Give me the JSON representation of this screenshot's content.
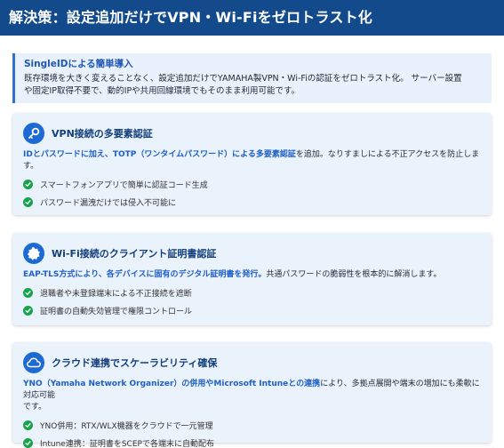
{
  "header": {
    "title": "解決策：設定追加だけでVPN・Wi-Fiをゼロトラスト化"
  },
  "intro": {
    "title": "SingleIDによる簡単導入",
    "line1": "既存環境を大きく変えることなく、設定追加だけでYAMAHA製VPN・Wi-Fiの認証をゼロトラスト化。 サーバー設置",
    "line2": "や固定IP取得不要で、動的IPや共用回線環境でもそのまま利用可能です。"
  },
  "cards": [
    {
      "icon": "key-icon",
      "title": "VPN接続の多要素認証",
      "desc_highlight": "IDとパスワードに加え、TOTP（ワンタイムパスワード）による多要素認証",
      "desc_rest": "を追加。なりすましによる不正アクセスを防止しま",
      "desc_line2": "す。",
      "bullets": [
        "スマートフォンアプリで簡単に認証コード生成",
        "パスワード漏洩だけでは侵入不可能に"
      ]
    },
    {
      "icon": "badge-icon",
      "title": "Wi-Fi接続のクライアント証明書認証",
      "desc_highlight": "EAP-TLS方式により、各デバイスに固有のデジタル証明書を発行。",
      "desc_rest": "共通パスワードの脆弱性を根本的に解消します。",
      "bullets": [
        "退職者や未登録端末による不正接続を遮断",
        "証明書の自動失効管理で権限コントロール"
      ]
    },
    {
      "icon": "cloud-icon",
      "title": "クラウド連携でスケーラビリティ確保",
      "desc_highlight": "YNO（Yamaha Network Organizer）の併用やMicrosoft Intuneとの連携",
      "desc_rest": "により、多拠点展開や端末の増加にも柔軟に対応可能",
      "desc_line2": "です。",
      "bullets": [
        "YNO併用：RTX/WLX機器をクラウドで一元管理",
        "Intune連携：証明書をSCEPで各端末に自動配布"
      ]
    }
  ],
  "colors": {
    "header_bg": "#124a8c",
    "accent": "#1e6ad3",
    "highlight": "#1f5fc8",
    "card_bg": "#eaf2fc",
    "check": "#16a34a"
  }
}
